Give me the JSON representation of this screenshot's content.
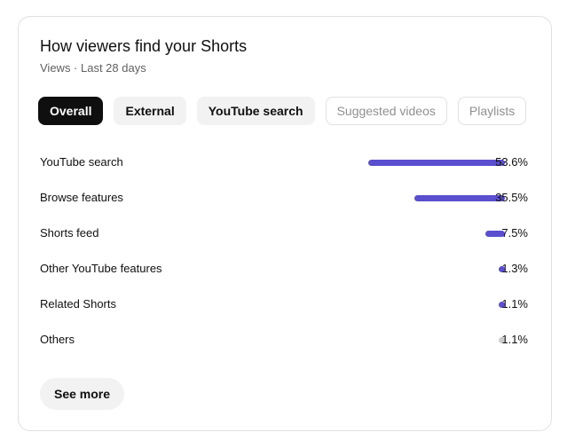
{
  "card": {
    "title": "How viewers find your Shorts",
    "subtitle": "Views · Last 28 days"
  },
  "tabs": [
    {
      "label": "Overall",
      "state": "active"
    },
    {
      "label": "External",
      "state": "normal"
    },
    {
      "label": "YouTube search",
      "state": "normal"
    },
    {
      "label": "Suggested videos",
      "state": "disabled"
    },
    {
      "label": "Playlists",
      "state": "disabled"
    }
  ],
  "sources": [
    {
      "label": "YouTube search",
      "value": "53.6%",
      "percent": 53.6,
      "color": "#5b4fcf"
    },
    {
      "label": "Browse features",
      "value": "35.5%",
      "percent": 35.5,
      "color": "#5b4fcf"
    },
    {
      "label": "Shorts feed",
      "value": "7.5%",
      "percent": 7.5,
      "color": "#5b4fcf"
    },
    {
      "label": "Other YouTube features",
      "value": "1.3%",
      "percent": 1.3,
      "color": "#5b4fcf"
    },
    {
      "label": "Related Shorts",
      "value": "1.1%",
      "percent": 1.1,
      "color": "#5b4fcf"
    },
    {
      "label": "Others",
      "value": "1.1%",
      "percent": 1.1,
      "color": "#cccccc"
    }
  ],
  "see_more_label": "See more",
  "colors": {
    "accent": "#5b4fcf",
    "muted_bar": "#cccccc",
    "active_chip": "#0f0f0f"
  }
}
